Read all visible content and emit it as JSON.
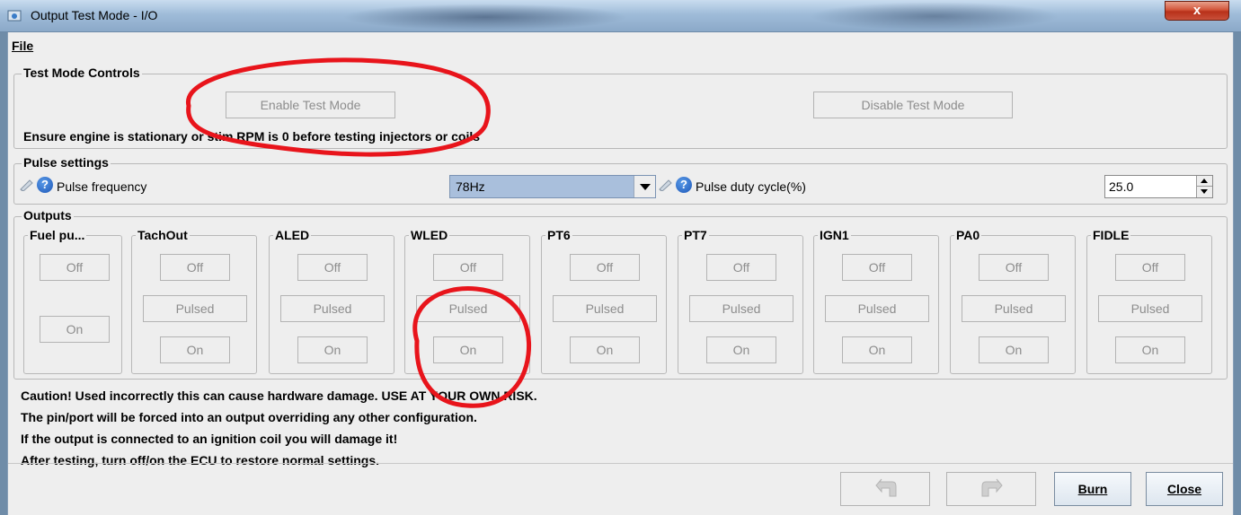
{
  "window": {
    "title": "Output Test Mode - I/O",
    "close_glyph": "x"
  },
  "menu": {
    "file": "File"
  },
  "test_mode": {
    "legend": "Test Mode Controls",
    "enable_label": "Enable Test Mode",
    "disable_label": "Disable Test Mode",
    "warning": "Ensure engine is stationary or stim RPM is 0 before testing injectors or coils"
  },
  "pulse": {
    "legend": "Pulse settings",
    "freq_label": "Pulse frequency",
    "freq_value": "78Hz",
    "duty_label": "Pulse duty cycle(%)",
    "duty_value": "25.0",
    "help_glyph": "?"
  },
  "outputs": {
    "legend": "Outputs",
    "fuel": {
      "name": "Fuel pu...",
      "off": "Off",
      "on": "On"
    },
    "channels": [
      {
        "name": "TachOut",
        "off": "Off",
        "pulsed": "Pulsed",
        "on": "On"
      },
      {
        "name": "ALED",
        "off": "Off",
        "pulsed": "Pulsed",
        "on": "On"
      },
      {
        "name": "WLED",
        "off": "Off",
        "pulsed": "Pulsed",
        "on": "On"
      },
      {
        "name": "PT6",
        "off": "Off",
        "pulsed": "Pulsed",
        "on": "On"
      },
      {
        "name": "PT7",
        "off": "Off",
        "pulsed": "Pulsed",
        "on": "On"
      },
      {
        "name": "IGN1",
        "off": "Off",
        "pulsed": "Pulsed",
        "on": "On"
      },
      {
        "name": "PA0",
        "off": "Off",
        "pulsed": "Pulsed",
        "on": "On"
      },
      {
        "name": "FIDLE",
        "off": "Off",
        "pulsed": "Pulsed",
        "on": "On"
      }
    ]
  },
  "cautions": [
    "Caution! Used incorrectly this can cause hardware damage. USE AT YOUR OWN RISK.",
    "The pin/port will be forced into an output overriding any other configuration.",
    "If the output is connected to an ignition coil you will damage it!",
    "After testing, turn off/on the ECU to restore normal settings."
  ],
  "footer": {
    "burn": "Burn",
    "close": "Close"
  },
  "colors": {
    "annotation": "#e8141b",
    "combo_bg": "#a9bfdc",
    "window_bg": "#eeeeee"
  }
}
